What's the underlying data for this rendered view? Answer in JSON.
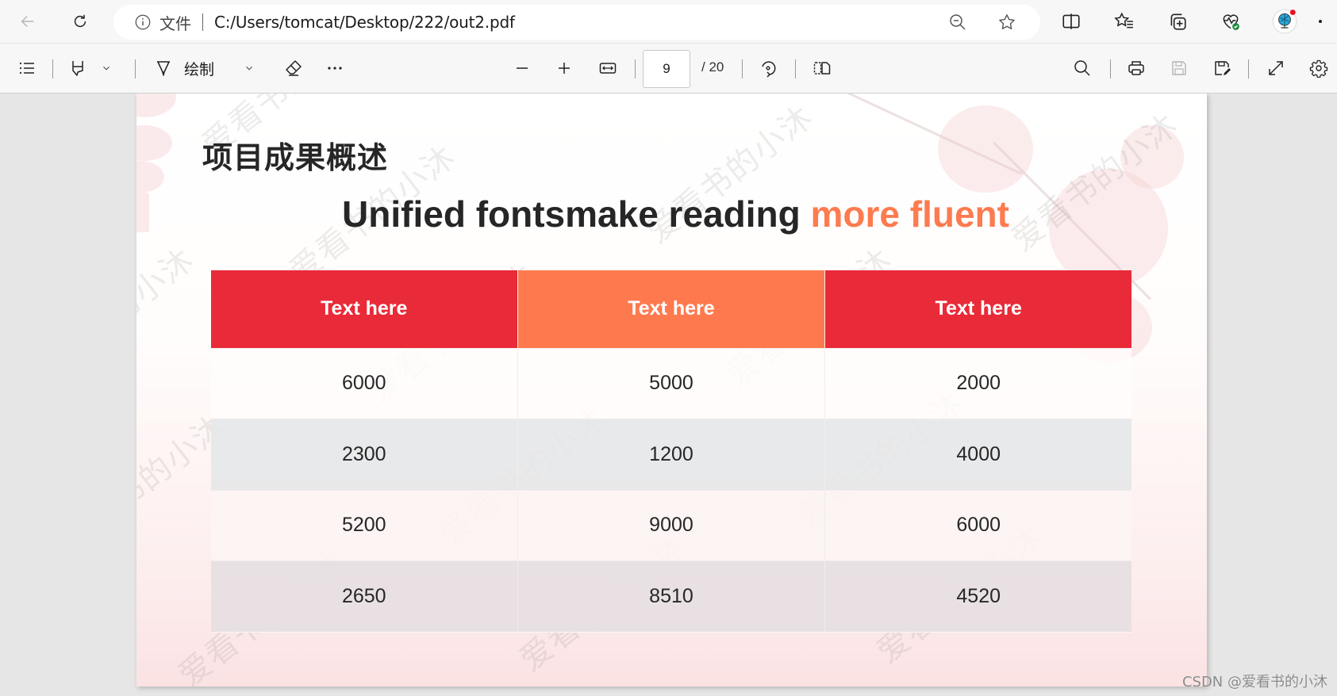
{
  "browser": {
    "address": {
      "scheme_label": "文件",
      "url": "C:/Users/tomcat/Desktop/222/out2.pdf"
    },
    "icons": [
      "back-icon",
      "refresh-icon",
      "info-icon",
      "zoom-out-icon",
      "favorite-star-icon",
      "split-screen-icon",
      "favorites-list-icon",
      "collections-icon",
      "browser-essentials-icon",
      "profile-avatar-icon"
    ]
  },
  "pdf_toolbar": {
    "draw_label": "绘制",
    "current_page": "9",
    "total_pages": "/ 20"
  },
  "slide": {
    "title": "项目成果概述",
    "subtitle_main": "Unified fontsmake reading ",
    "subtitle_accent": "more fluent",
    "table": {
      "headers": [
        "Text here",
        "Text here",
        "Text here"
      ],
      "rows": [
        [
          "6000",
          "5000",
          "2000"
        ],
        [
          "2300",
          "1200",
          "4000"
        ],
        [
          "5200",
          "9000",
          "6000"
        ],
        [
          "2650",
          "8510",
          "4520"
        ]
      ]
    },
    "watermark_text": "爱看书的小沐"
  },
  "credit": "CSDN @爱看书的小沐",
  "colors": {
    "header_red": "#e92a38",
    "header_orange": "#fe7a4e",
    "accent_orange": "#fd7b4f"
  }
}
